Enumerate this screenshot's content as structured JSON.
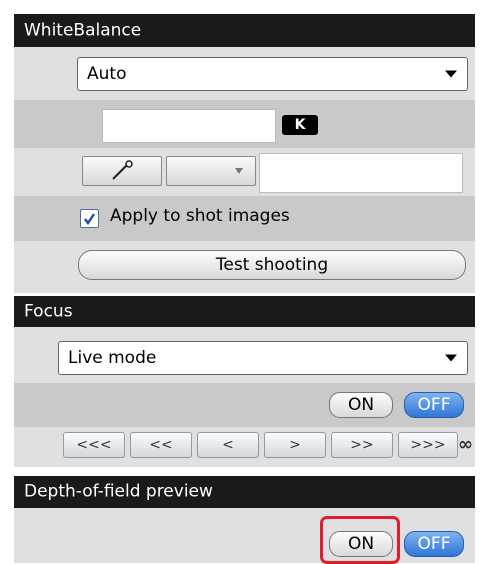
{
  "white_balance": {
    "header": "WhiteBalance",
    "mode_value": "Auto",
    "kelvin_badge": "K",
    "kelvin_value": "",
    "apply_label": "Apply to shot images",
    "apply_checked": true,
    "test_button": "Test shooting"
  },
  "focus": {
    "header": "Focus",
    "mode_value": "Live mode",
    "on_label": "ON",
    "off_label": "OFF",
    "nav": [
      "<<<",
      "<<",
      "<",
      ">",
      ">>",
      ">>>"
    ],
    "infinity": "∞"
  },
  "dof": {
    "header": "Depth-of-field preview",
    "on_label": "ON",
    "off_label": "OFF"
  },
  "colors": {
    "header_bg": "#1a1a1a",
    "off_active": "#2f76d6",
    "highlight": "#e01d28"
  }
}
